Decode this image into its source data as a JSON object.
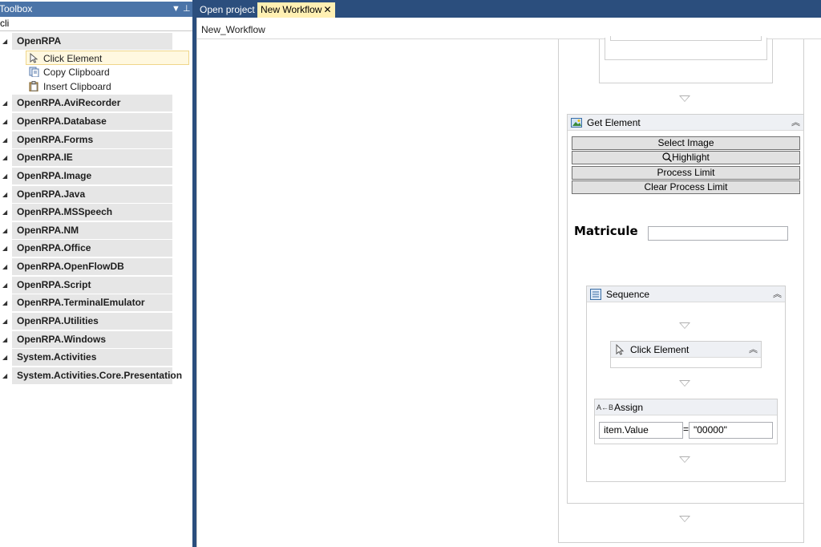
{
  "toolbox": {
    "title": "Toolbox",
    "pin_glyph": "⊥",
    "dropdown_glyph": "▼",
    "search_value": "cli",
    "categories": [
      {
        "label": "OpenRPA",
        "expanded": true
      },
      {
        "label": "OpenRPA.AviRecorder"
      },
      {
        "label": "OpenRPA.Database"
      },
      {
        "label": "OpenRPA.Forms"
      },
      {
        "label": "OpenRPA.IE"
      },
      {
        "label": "OpenRPA.Image"
      },
      {
        "label": "OpenRPA.Java"
      },
      {
        "label": "OpenRPA.MSSpeech"
      },
      {
        "label": "OpenRPA.NM"
      },
      {
        "label": "OpenRPA.Office"
      },
      {
        "label": "OpenRPA.OpenFlowDB"
      },
      {
        "label": "OpenRPA.Script"
      },
      {
        "label": "OpenRPA.TerminalEmulator"
      },
      {
        "label": "OpenRPA.Utilities"
      },
      {
        "label": "OpenRPA.Windows"
      },
      {
        "label": "System.Activities"
      },
      {
        "label": "System.Activities.Core.Presentation"
      }
    ],
    "tools": [
      {
        "label": "Click Element",
        "icon": "cursor-icon",
        "selected": true
      },
      {
        "label": "Copy Clipboard",
        "icon": "copy-clipboard-icon"
      },
      {
        "label": "Insert Clipboard",
        "icon": "insert-clipboard-icon"
      }
    ]
  },
  "tabs": [
    {
      "label": "Open project",
      "active": false
    },
    {
      "label": "New Workflow",
      "active": true,
      "close_glyph": "✕"
    }
  ],
  "designer": {
    "breadcrumb": "New_Workflow",
    "get_element": {
      "title": "Get Element",
      "buttons": {
        "select_image": "Select Image",
        "highlight": "Highlight",
        "process_limit": "Process Limit",
        "clear_process_limit": "Clear Process Limit"
      },
      "matricule_label": "Matricule",
      "matricule_value": ""
    },
    "sequence": {
      "title": "Sequence",
      "click_element_title": "Click Element",
      "assign": {
        "title": "Assign",
        "icon_text": "A←B",
        "to_value": "item.Value",
        "equals": "=",
        "value": "\"00000\""
      }
    },
    "collapse_glyph": "︽"
  },
  "colors": {
    "chrome_blue": "#2b4e7d",
    "header_blue": "#4b74a8",
    "active_tab": "#fff0b3",
    "category_bg": "#e6e6e6"
  }
}
